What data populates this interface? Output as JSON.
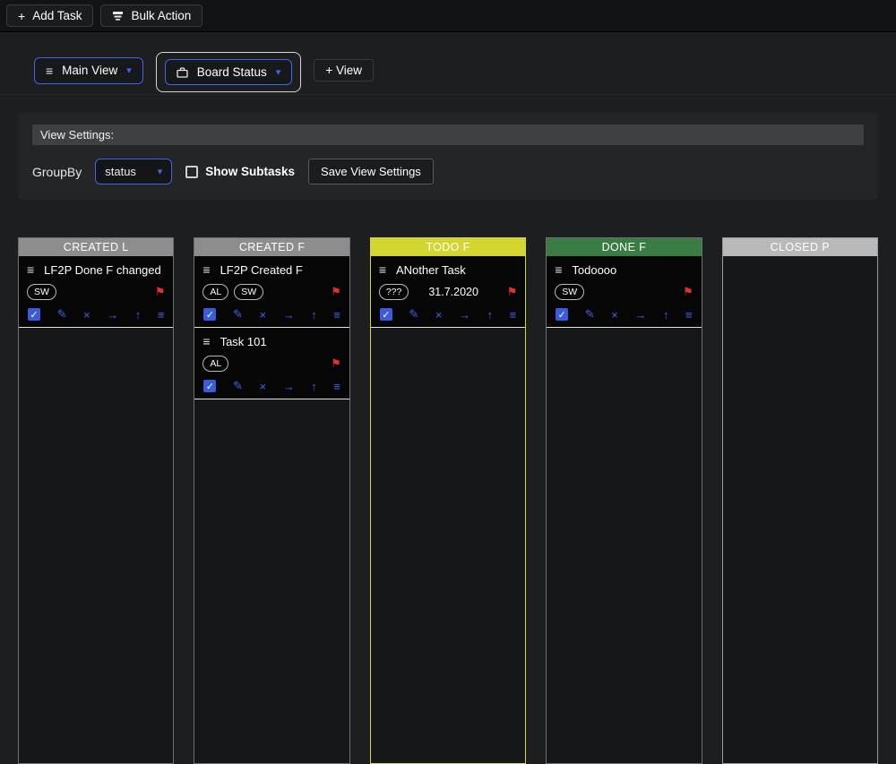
{
  "toolbar": {
    "add_task_label": "Add Task",
    "bulk_action_label": "Bulk Action"
  },
  "tabs": {
    "main_view_label": "Main View",
    "board_status_label": "Board Status",
    "add_view_label": "+ View"
  },
  "view_settings": {
    "header": "View Settings:",
    "groupby_label": "GroupBy",
    "groupby_value": "status",
    "show_subtasks_label": "Show Subtasks",
    "save_button_label": "Save View Settings"
  },
  "icons": {
    "plus": "+",
    "menu": "≡",
    "chevron": "▾",
    "flag": "⚑",
    "check": "✓",
    "pencil": "✎",
    "close": "×",
    "arrow_right": "→",
    "arrow_up": "↑",
    "drag": "≡"
  },
  "colors": {
    "accent_blue": "#4263eb",
    "flag_red": "#e03131",
    "page_bg": "#1c1e1f",
    "card_bg": "#060606"
  },
  "board": {
    "columns": [
      {
        "title": "CREATED L",
        "header_bg": "#8d8d8d",
        "border_color": "#6f6f6f",
        "cards": [
          {
            "title": "LF2P Done F changed",
            "badges": [
              "SW"
            ],
            "date": "",
            "flag": true
          }
        ]
      },
      {
        "title": "CREATED F",
        "header_bg": "#8d8d8d",
        "border_color": "#6f6f6f",
        "cards": [
          {
            "title": "LF2P Created F",
            "badges": [
              "AL",
              "SW"
            ],
            "date": "",
            "flag": true
          },
          {
            "title": "Task 101",
            "badges": [
              "AL"
            ],
            "date": "",
            "flag": true
          }
        ]
      },
      {
        "title": "TODO F",
        "header_bg": "#d3d531",
        "border_color": "#d3d531",
        "cards": [
          {
            "title": "ANother Task",
            "badges": [
              "???"
            ],
            "date": "31.7.2020",
            "flag": true
          }
        ]
      },
      {
        "title": "DONE F",
        "header_bg": "#3a7d44",
        "border_color": "#6f6f6f",
        "cards": [
          {
            "title": "Todoooo",
            "badges": [
              "SW"
            ],
            "date": "",
            "flag": true
          }
        ]
      },
      {
        "title": "CLOSED P",
        "header_bg": "#b9b9b9",
        "border_color": "#9a9a9a",
        "cards": []
      }
    ]
  }
}
